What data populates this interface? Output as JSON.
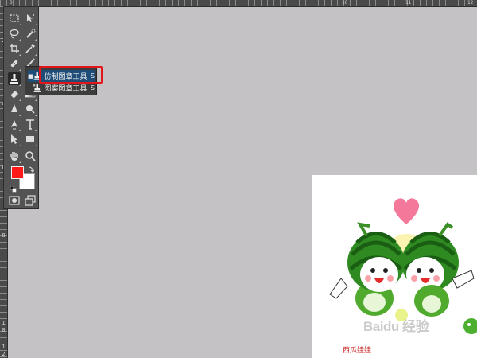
{
  "ruler": {
    "top_ticks": [
      "0",
      "10",
      "11",
      "12"
    ],
    "left_ticks": [
      "2",
      "4",
      "6",
      "8",
      "1",
      "0",
      "1",
      "2"
    ]
  },
  "toolbar": {
    "tools": [
      {
        "name": "marquee-icon"
      },
      {
        "name": "move-icon"
      },
      {
        "name": "lasso-icon"
      },
      {
        "name": "quick-selection-icon"
      },
      {
        "name": "crop-icon"
      },
      {
        "name": "eyedropper-icon"
      },
      {
        "name": "healing-brush-icon"
      },
      {
        "name": "brush-icon"
      },
      {
        "name": "clone-stamp-icon"
      },
      {
        "name": "history-brush-icon"
      },
      {
        "name": "eraser-icon"
      },
      {
        "name": "gradient-icon"
      },
      {
        "name": "blur-icon"
      },
      {
        "name": "dodge-icon"
      },
      {
        "name": "pen-icon"
      },
      {
        "name": "type-icon"
      },
      {
        "name": "path-selection-icon"
      },
      {
        "name": "rectangle-icon"
      },
      {
        "name": "hand-icon"
      },
      {
        "name": "zoom-icon"
      },
      {
        "name": "quick-mask-icon"
      },
      {
        "name": "screen-mode-icon"
      }
    ],
    "foreground_color": "#ff1a1a",
    "background_color": "#ffffff"
  },
  "flyout": {
    "items": [
      {
        "label": "仿制图章工具",
        "shortcut": "S",
        "selected": true,
        "bullet": "■"
      },
      {
        "label": "图案图章工具",
        "shortcut": "S",
        "selected": false,
        "bullet": ""
      }
    ]
  },
  "document": {
    "caption": "西瓜娃娃",
    "watermark": "Baidu 经验"
  },
  "colors": {
    "workspace": "#c4c2c4",
    "toolbar": "#535353",
    "highlight": "#e3151a"
  }
}
